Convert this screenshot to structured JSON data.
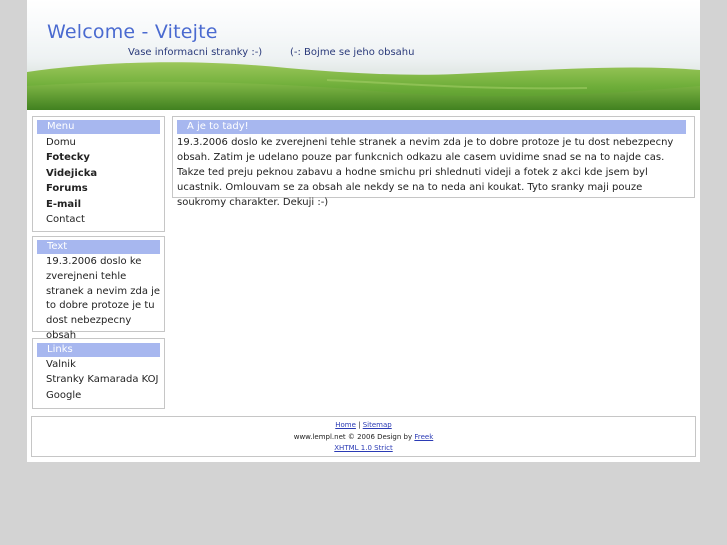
{
  "header": {
    "title": "Welcome - Vitejte",
    "slogan_left": "Vase informacni stranky :-)",
    "slogan_right": "(-: Bojme se jeho obsahu"
  },
  "menu": {
    "title": "Menu",
    "items": [
      {
        "label": "Domu",
        "bold": false
      },
      {
        "label": "Fotecky",
        "bold": true
      },
      {
        "label": "Videjicka",
        "bold": true
      },
      {
        "label": "Forums",
        "bold": true
      },
      {
        "label": "E-mail",
        "bold": true
      },
      {
        "label": "Contact",
        "bold": false
      }
    ]
  },
  "text_box": {
    "title": "Text",
    "body": "19.3.2006 doslo ke zverejneni tehle stranek a nevim zda je to dobre protoze je tu dost nebezpecny obsah"
  },
  "links": {
    "title": "Links",
    "items": [
      "Valnik",
      "Stranky Kamarada KOJ",
      "Google"
    ]
  },
  "main": {
    "title": "A je to tady!",
    "body": "19.3.2006 doslo ke zverejneni tehle stranek a nevim zda je to dobre protoze je tu dost nebezpecny obsah. Zatim je udelano pouze par funkcnich odkazu ale casem uvidime snad se na to najde cas. Takze ted preju peknou zabavu a hodne smichu pri shlednuti videji a fotek z akci kde jsem byl ucastnik. Omlouvam se za obsah ale nekdy se na to neda ani koukat. Tyto sranky maji pouze soukromy charakter. Dekuji :-)"
  },
  "footer": {
    "home": "Home",
    "separator": " | ",
    "sitemap": "Sitemap",
    "copyright": "www.lempl.net © 2006 Design by ",
    "designer": "Freek",
    "validator": "XHTML 1.0 Strict"
  },
  "colors": {
    "background": "#d3d3d3",
    "title_blue": "#4a6ad0",
    "box_header": "#a7b7ef",
    "grass": "#5e9e32"
  }
}
